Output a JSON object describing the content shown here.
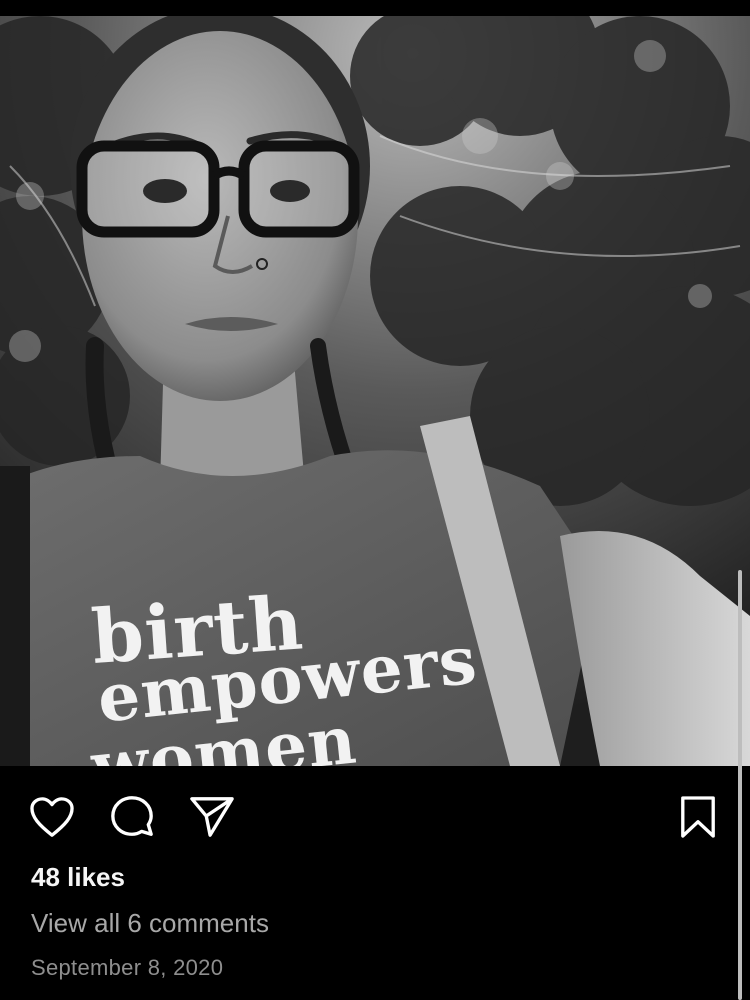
{
  "post": {
    "photo": {
      "alt_icon": "selfie-photo",
      "shirt_lines": [
        "birth",
        "empowers",
        "women"
      ]
    },
    "actions": {
      "like_icon": "heart-icon",
      "comment_icon": "comment-icon",
      "share_icon": "send-icon",
      "save_icon": "bookmark-icon"
    },
    "likes_text": "48 likes",
    "view_comments_text": "View all 6 comments",
    "date_text": "September 8, 2020"
  },
  "colors": {
    "background": "#000000",
    "primary_text": "#f5f5f5",
    "secondary_text": "#a8a8a8",
    "date_text": "#8e8e8e"
  }
}
